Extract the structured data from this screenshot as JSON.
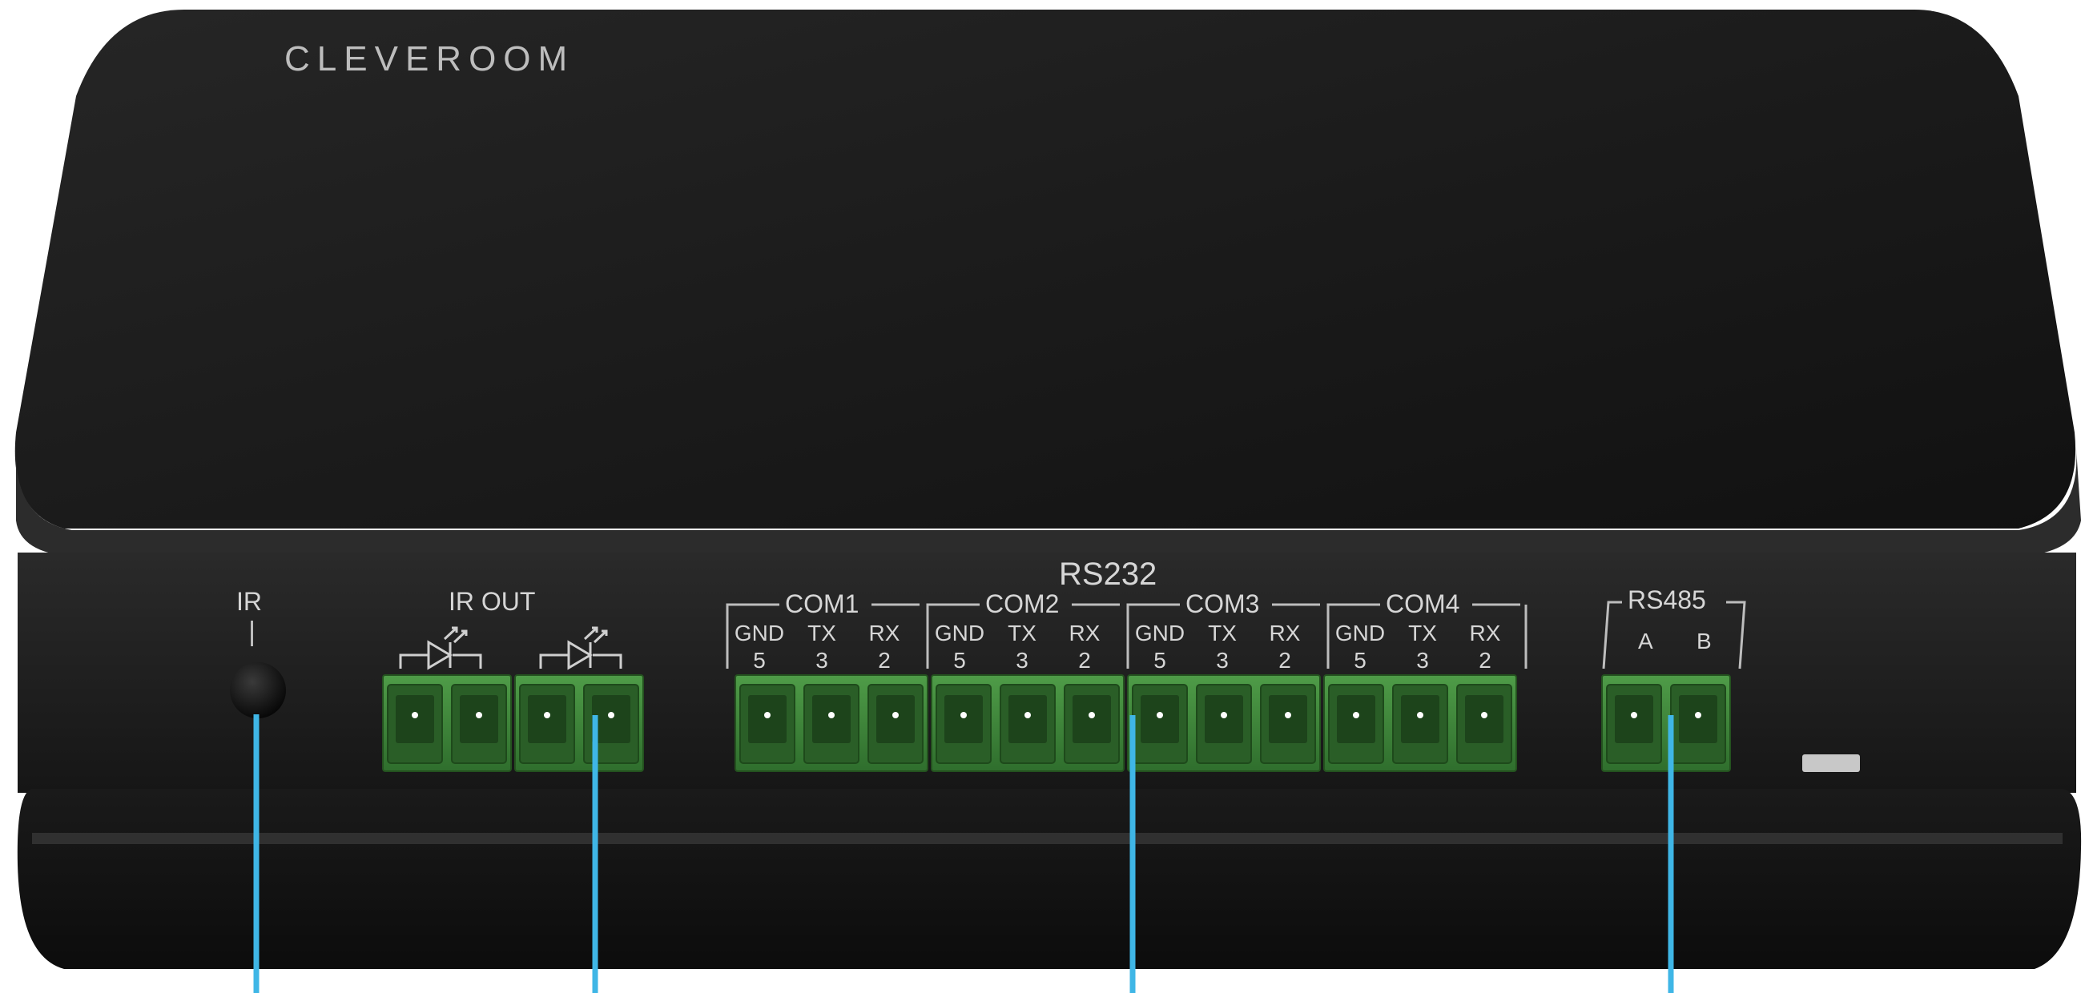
{
  "device": {
    "brand": "CLEVEROOM",
    "ir_label": "IR",
    "ir_out_label": "IR OUT",
    "rs232_label": "RS232",
    "rs485_label": "RS485",
    "com_ports": [
      {
        "name": "COM1",
        "pins": [
          {
            "signal": "GND",
            "pin": "5"
          },
          {
            "signal": "TX",
            "pin": "3"
          },
          {
            "signal": "RX",
            "pin": "2"
          }
        ]
      },
      {
        "name": "COM2",
        "pins": [
          {
            "signal": "GND",
            "pin": "5"
          },
          {
            "signal": "TX",
            "pin": "3"
          },
          {
            "signal": "RX",
            "pin": "2"
          }
        ]
      },
      {
        "name": "COM3",
        "pins": [
          {
            "signal": "GND",
            "pin": "5"
          },
          {
            "signal": "TX",
            "pin": "3"
          },
          {
            "signal": "RX",
            "pin": "2"
          }
        ]
      },
      {
        "name": "COM4",
        "pins": [
          {
            "signal": "GND",
            "pin": "5"
          },
          {
            "signal": "TX",
            "pin": "3"
          },
          {
            "signal": "RX",
            "pin": "2"
          }
        ]
      }
    ],
    "rs485_pins": [
      "A",
      "B"
    ],
    "icons": [
      "led-emitter-icon",
      "led-emitter-icon"
    ],
    "colors": {
      "body": "#1c1c1c",
      "terminal_green": "#3f8a3c",
      "callout_line": "#3fb6e6",
      "label_text": "#d6d6d6"
    }
  }
}
